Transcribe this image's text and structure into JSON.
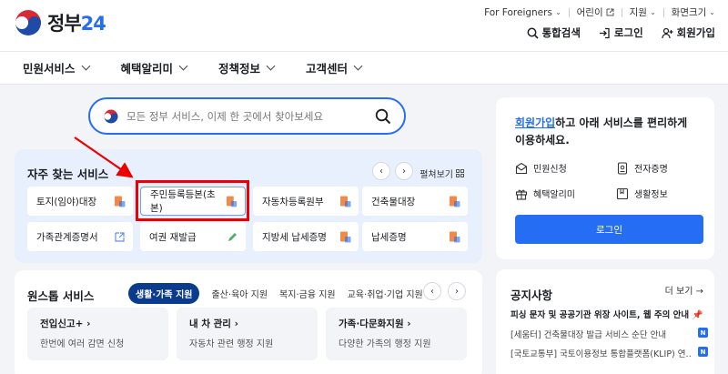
{
  "header": {
    "logo_text": "정부",
    "logo_num": "24",
    "util": [
      {
        "label": "For Foreigners",
        "suffix": "chevron-down"
      },
      {
        "label": "어린이",
        "suffix": "external-link"
      },
      {
        "label": "지원",
        "suffix": "chevron-down"
      },
      {
        "label": "화면크기",
        "suffix": "chevron-down"
      }
    ],
    "actions": [
      {
        "label": "통합검색",
        "icon": "search-icon"
      },
      {
        "label": "로그인",
        "icon": "login-icon"
      },
      {
        "label": "회원가입",
        "icon": "user-add-icon"
      }
    ]
  },
  "nav": {
    "items": [
      "민원서비스",
      "혜택알리미",
      "정책정보",
      "고객센터"
    ]
  },
  "search": {
    "placeholder": "모든 정부 서비스, 이제 한 곳에서 찾아보세요"
  },
  "frequent": {
    "title": "자주 찾는 서비스",
    "expand_label": "펼쳐보기",
    "services": [
      {
        "label": "토지(임야)대장",
        "icon": "document-icon"
      },
      {
        "label": "주민등록등본(초본)",
        "icon": "document-icon"
      },
      {
        "label": "자동차등록원부",
        "icon": "document-icon"
      },
      {
        "label": "건축물대장",
        "icon": "document-icon"
      },
      {
        "label": "가족관계증명서",
        "icon": "external-link-icon"
      },
      {
        "label": "여권 재발급",
        "icon": "edit-icon"
      },
      {
        "label": "지방세 납세증명",
        "icon": "document-icon"
      },
      {
        "label": "납세증명",
        "icon": "document-icon"
      }
    ]
  },
  "onestop": {
    "title": "원스톱 서비스",
    "tabs": [
      "생활·가족 지원",
      "출산·육아 지원",
      "복지·금융 지원",
      "교육·취업·기업 지원"
    ],
    "cards": [
      {
        "title": "전입신고+",
        "desc": "한번에 여러 감면 신청"
      },
      {
        "title": "내 차 관리",
        "desc": "자동차 관련 행정 지원"
      },
      {
        "title": "가족·다문화지원",
        "desc": "다양한 가족의 행정 지원"
      }
    ]
  },
  "login_card": {
    "msg_link": "회원가입",
    "msg_rest": "하고 아래 서비스를 편리하게 이용하세요.",
    "items": [
      "민원신청",
      "전자증명",
      "혜택알리미",
      "생활정보"
    ],
    "button": "로그인"
  },
  "notice": {
    "title": "공지사항",
    "more": "더 보기",
    "headline": "피싱 문자 및 공공기관 위장 사이트, 웹 주의 안내",
    "rows": [
      {
        "text": "[세움터] 건축물대장 발급 서비스 순단 안내",
        "badge": "N"
      },
      {
        "text": "[국토교통부] 국토이용정보 통합플랫폼(KLIP) 연…",
        "badge": "N"
      }
    ]
  },
  "colors": {
    "accent": "#256ef4",
    "nav_dark": "#0b3b8c",
    "highlight": "#e00000"
  }
}
